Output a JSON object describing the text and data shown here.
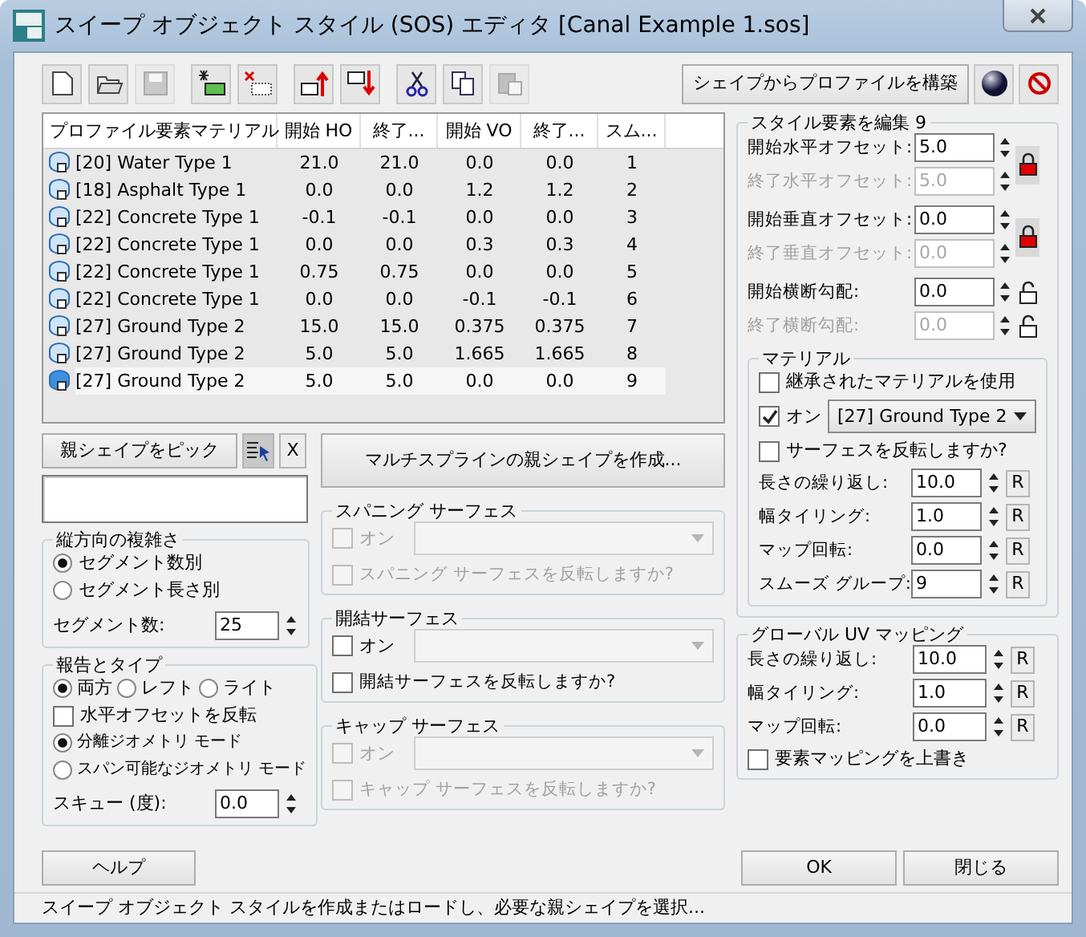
{
  "window": {
    "title": "スイープ オブジェクト スタイル (SOS) エディタ [Canal Example 1.sos]"
  },
  "toolbar": {
    "tool_groups": [
      [
        {
          "kind": "new",
          "disabled": false
        },
        {
          "kind": "open",
          "disabled": false
        },
        {
          "kind": "save",
          "disabled": true
        }
      ],
      [
        {
          "kind": "add",
          "disabled": false
        },
        {
          "kind": "delete",
          "disabled": false
        }
      ],
      [
        {
          "kind": "move_up",
          "disabled": false
        },
        {
          "kind": "move_down",
          "disabled": false
        }
      ],
      [
        {
          "kind": "cut",
          "disabled": false
        },
        {
          "kind": "copy",
          "disabled": false
        },
        {
          "kind": "paste",
          "disabled": true
        }
      ]
    ],
    "build_button": "シェイプからプロファイルを構築",
    "right_tools": [
      {
        "kind": "material",
        "disabled": false
      },
      {
        "kind": "prohibit",
        "disabled": false
      }
    ]
  },
  "table": {
    "columns": [
      "プロファイル要素マテリアル",
      "開始 HO",
      "終了...",
      "開始 VO",
      "終了...",
      "スム..."
    ],
    "rows": [
      {
        "cells": [
          "[20] Water Type 1",
          "21.0",
          "21.0",
          "0.0",
          "0.0",
          "1"
        ],
        "selected": false
      },
      {
        "cells": [
          "[18] Asphalt Type 1",
          "0.0",
          "0.0",
          "1.2",
          "1.2",
          "2"
        ],
        "selected": false
      },
      {
        "cells": [
          "[22] Concrete Type 1",
          "-0.1",
          "-0.1",
          "0.0",
          "0.0",
          "3"
        ],
        "selected": false
      },
      {
        "cells": [
          "[22] Concrete Type 1",
          "0.0",
          "0.0",
          "0.3",
          "0.3",
          "4"
        ],
        "selected": false
      },
      {
        "cells": [
          "[22] Concrete Type 1",
          "0.75",
          "0.75",
          "0.0",
          "0.0",
          "5"
        ],
        "selected": false
      },
      {
        "cells": [
          "[22] Concrete Type 1",
          "0.0",
          "0.0",
          "-0.1",
          "-0.1",
          "6"
        ],
        "selected": false
      },
      {
        "cells": [
          "[27] Ground Type 2",
          "15.0",
          "15.0",
          "0.375",
          "0.375",
          "7"
        ],
        "selected": false
      },
      {
        "cells": [
          "[27] Ground Type 2",
          "5.0",
          "5.0",
          "1.665",
          "1.665",
          "8"
        ],
        "selected": false
      },
      {
        "cells": [
          "[27] Ground Type 2",
          "5.0",
          "5.0",
          "0.0",
          "0.0",
          "9"
        ],
        "selected": true
      }
    ]
  },
  "parent_shape": {
    "pick_button": "親シェイプをピック",
    "clear_button": "X"
  },
  "length_complexity": {
    "title": "縦方向の複雑さ",
    "options": [
      {
        "label": "セグメント数別",
        "selected": true
      },
      {
        "label": "セグメント長さ別",
        "selected": false
      }
    ],
    "segments": {
      "label": "セグメント数:",
      "value": "25"
    }
  },
  "report_type": {
    "title": "報告とタイプ",
    "sides": [
      {
        "label": "両方",
        "selected": true
      },
      {
        "label": "レフト",
        "selected": false
      },
      {
        "label": "ライト",
        "selected": false
      }
    ],
    "flip_horizontal": {
      "label": "水平オフセットを反転",
      "checked": false
    },
    "modes": [
      {
        "label": "分離ジオメトリ モード",
        "selected": true
      },
      {
        "label": "スパン可能なジオメトリ モード",
        "selected": false
      }
    ],
    "skew": {
      "label": "スキュー (度):",
      "value": "0.0"
    }
  },
  "multispline_button": "マルチスプラインの親シェイプを作成...",
  "surfaces": [
    {
      "title": "スパニング サーフェス",
      "disabled": true,
      "on": {
        "label": "オン",
        "checked": false
      },
      "flip": {
        "label": "スパニング サーフェスを反転しますか?",
        "checked": false
      }
    },
    {
      "title": "開結サーフェス",
      "disabled": false,
      "on": {
        "label": "オン",
        "checked": false
      },
      "flip": {
        "label": "開結サーフェスを反転しますか?",
        "checked": false
      }
    },
    {
      "title": "キャップ サーフェス",
      "disabled": true,
      "on": {
        "label": "オン",
        "checked": false
      },
      "flip": {
        "label": "キャップ サーフェスを反転しますか?",
        "checked": false
      }
    }
  ],
  "edit_element": {
    "title": "スタイル要素を編集 9",
    "offsets": [
      {
        "start": {
          "label": "開始水平オフセット:",
          "value": "5.0"
        },
        "end": {
          "label": "終了水平オフセット:",
          "value": "5.0",
          "disabled": true
        },
        "locked": true
      },
      {
        "start": {
          "label": "開始垂直オフセット:",
          "value": "0.0"
        },
        "end": {
          "label": "終了垂直オフセット:",
          "value": "0.0",
          "disabled": true
        },
        "locked": true
      },
      {
        "start": {
          "label": "開始横断勾配:",
          "value": "0.0"
        },
        "end": {
          "label": "終了横断勾配:",
          "value": "0.0",
          "disabled": true
        },
        "locked": false
      }
    ],
    "material": {
      "title": "マテリアル",
      "inherit": {
        "label": "継承されたマテリアルを使用",
        "checked": false
      },
      "on": {
        "label": "オン",
        "checked": true
      },
      "material_value": "[27] Ground Type 2",
      "flip": {
        "label": "サーフェスを反転しますか?",
        "checked": false
      },
      "params": [
        {
          "label": "長さの繰り返し:",
          "value": "10.0",
          "reset": "R"
        },
        {
          "label": "幅タイリング:",
          "value": "1.0",
          "reset": "R"
        },
        {
          "label": "マップ回転:",
          "value": "0.0",
          "reset": "R"
        },
        {
          "label": "スムーズ グループ:",
          "value": "9",
          "reset": "R"
        }
      ]
    }
  },
  "global_uv": {
    "title": "グローバル UV マッピング",
    "params": [
      {
        "label": "長さの繰り返し:",
        "value": "10.0",
        "reset": "R"
      },
      {
        "label": "幅タイリング:",
        "value": "1.0",
        "reset": "R"
      },
      {
        "label": "マップ回転:",
        "value": "0.0",
        "reset": "R"
      }
    ],
    "override": {
      "label": "要素マッピングを上書き",
      "checked": false
    }
  },
  "footer": {
    "help": "ヘルプ",
    "ok": "OK",
    "close": "閉じる"
  },
  "status_bar": "スイープ オブジェクト スタイルを作成またはロードし、必要な親シェイプを選択..."
}
